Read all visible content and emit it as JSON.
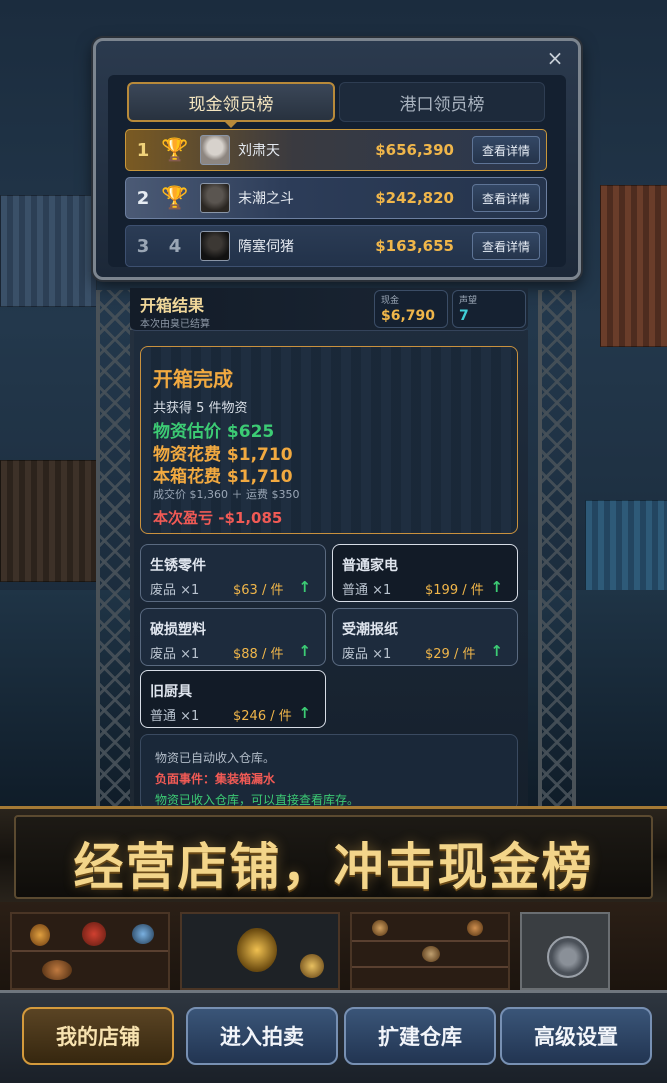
{
  "leaderboard": {
    "tabs": [
      {
        "label": "现金领员榜",
        "active": true
      },
      {
        "label": "港口领员榜",
        "active": false
      }
    ],
    "close_icon": "×",
    "rows": [
      {
        "rank": "1",
        "trophy": "gold-trophy-icon",
        "name": "刘肃天",
        "money": "$656,390",
        "button": "查看详情"
      },
      {
        "rank": "2",
        "trophy": "bronze-trophy-icon",
        "name": "末潮之斗",
        "money": "$242,820",
        "button": "查看详情"
      },
      {
        "rank": "3",
        "rank_b": "4",
        "name": "隋塞伺猪",
        "money": "$163,655",
        "button": "查看详情"
      }
    ]
  },
  "result": {
    "title": "开箱结果",
    "subtitle": "本次由臭已结算",
    "cash_label": "现金",
    "cash_value": "$6,790",
    "rep_label": "声望",
    "rep_value": "7"
  },
  "summary": {
    "title": "开箱完成",
    "count_line": "共获得 5 件物资",
    "estimate": "物资估价 $625",
    "item_cost": "物资花费 $1,710",
    "box_cost": "本箱花费 $1,710",
    "detail": "成交价 $1,360 ＋ 运费 $350",
    "profit": "本次盈亏 -$1,085"
  },
  "items": [
    {
      "name": "生锈零件",
      "quality": "废品 ×1",
      "price": "$63 / 件",
      "arrow": "↑",
      "highlight": false
    },
    {
      "name": "普通家电",
      "quality": "普通 ×1",
      "price": "$199 / 件",
      "arrow": "↑",
      "highlight": true
    },
    {
      "name": "破损塑料",
      "quality": "废品 ×1",
      "price": "$88 / 件",
      "arrow": "↑",
      "highlight": false
    },
    {
      "name": "受潮报纸",
      "quality": "废品 ×1",
      "price": "$29 / 件",
      "arrow": "↑",
      "highlight": false
    },
    {
      "name": "旧厨具",
      "quality": "普通 ×1",
      "price": "$246 / 件",
      "arrow": "↑",
      "highlight": true
    }
  ],
  "log": {
    "line1": "物资已自动收入仓库。",
    "line2": "负面事件：集装箱漏水",
    "line3": "物资已收入仓库，可以直接查看库存。"
  },
  "banner": {
    "text": "经营店铺，冲击现金榜"
  },
  "nav": [
    {
      "label": "我的店铺",
      "active": true
    },
    {
      "label": "进入拍卖",
      "active": false
    },
    {
      "label": "扩建仓库",
      "active": false
    },
    {
      "label": "高级设置",
      "active": false
    }
  ],
  "colors": {
    "gold": "#f0b64a",
    "orange_title": "#f1a940",
    "green": "#3ccb74",
    "red": "#f05a55",
    "cyan": "#40d0d8"
  }
}
